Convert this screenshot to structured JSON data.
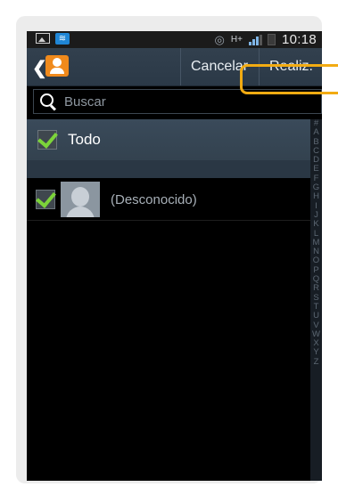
{
  "status_bar": {
    "time": "10:18",
    "icons": [
      "picture-icon",
      "wifi-icon",
      "eye-icon",
      "hplus-icon",
      "signal-icon",
      "battery-icon"
    ],
    "hplus_text": "H+"
  },
  "action_bar": {
    "back_icon": "chevron-left-icon",
    "app_icon": "contacts-icon",
    "cancel_label": "Cancelar",
    "done_label": "Realiz."
  },
  "search": {
    "placeholder": "Buscar",
    "value": ""
  },
  "select_all": {
    "label": "Todo",
    "checked": true
  },
  "contacts": [
    {
      "name": "(Desconocido)",
      "checked": true
    }
  ],
  "index": [
    "#",
    "A",
    "B",
    "C",
    "D",
    "E",
    "F",
    "G",
    "H",
    "I",
    "J",
    "K",
    "L",
    "M",
    "N",
    "O",
    "P",
    "Q",
    "R",
    "S",
    "T",
    "U",
    "V",
    "W",
    "X",
    "Y",
    "Z"
  ],
  "colors": {
    "accent_check": "#7cd43a",
    "highlight": "#f2ab12",
    "action_bar": "#2f3d4b",
    "app_icon": "#f08a1c"
  }
}
